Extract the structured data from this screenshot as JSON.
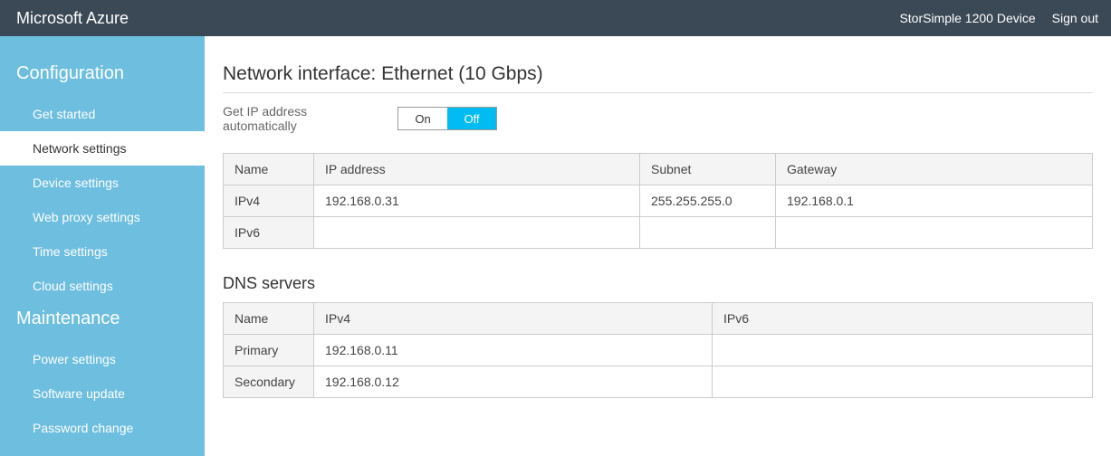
{
  "header": {
    "brand": "Microsoft Azure",
    "device": "StorSimple 1200 Device",
    "signout": "Sign out"
  },
  "sidebar": {
    "groups": [
      {
        "heading": "Configuration",
        "items": [
          {
            "label": "Get started",
            "active": false
          },
          {
            "label": "Network settings",
            "active": true
          },
          {
            "label": "Device settings",
            "active": false
          },
          {
            "label": "Web proxy settings",
            "active": false
          },
          {
            "label": "Time settings",
            "active": false
          },
          {
            "label": "Cloud settings",
            "active": false
          }
        ]
      },
      {
        "heading": "Maintenance",
        "items": [
          {
            "label": "Power settings",
            "active": false
          },
          {
            "label": "Software update",
            "active": false
          },
          {
            "label": "Password change",
            "active": false
          }
        ]
      }
    ]
  },
  "main": {
    "title": "Network interface: Ethernet (10 Gbps)",
    "dhcp": {
      "label": "Get IP address automatically",
      "on": "On",
      "off": "Off",
      "selected": "Off"
    },
    "netTable": {
      "headers": {
        "name": "Name",
        "ip": "IP address",
        "subnet": "Subnet",
        "gateway": "Gateway"
      },
      "rows": [
        {
          "name": "IPv4",
          "ip": "192.168.0.31",
          "subnet": "255.255.255.0",
          "gateway": "192.168.0.1"
        },
        {
          "name": "IPv6",
          "ip": "",
          "subnet": "",
          "gateway": ""
        }
      ]
    },
    "dnsTitle": "DNS servers",
    "dnsTable": {
      "headers": {
        "name": "Name",
        "ipv4": "IPv4",
        "ipv6": "IPv6"
      },
      "rows": [
        {
          "name": "Primary",
          "ipv4": "192.168.0.11",
          "ipv6": ""
        },
        {
          "name": "Secondary",
          "ipv4": "192.168.0.12",
          "ipv6": ""
        }
      ]
    }
  }
}
